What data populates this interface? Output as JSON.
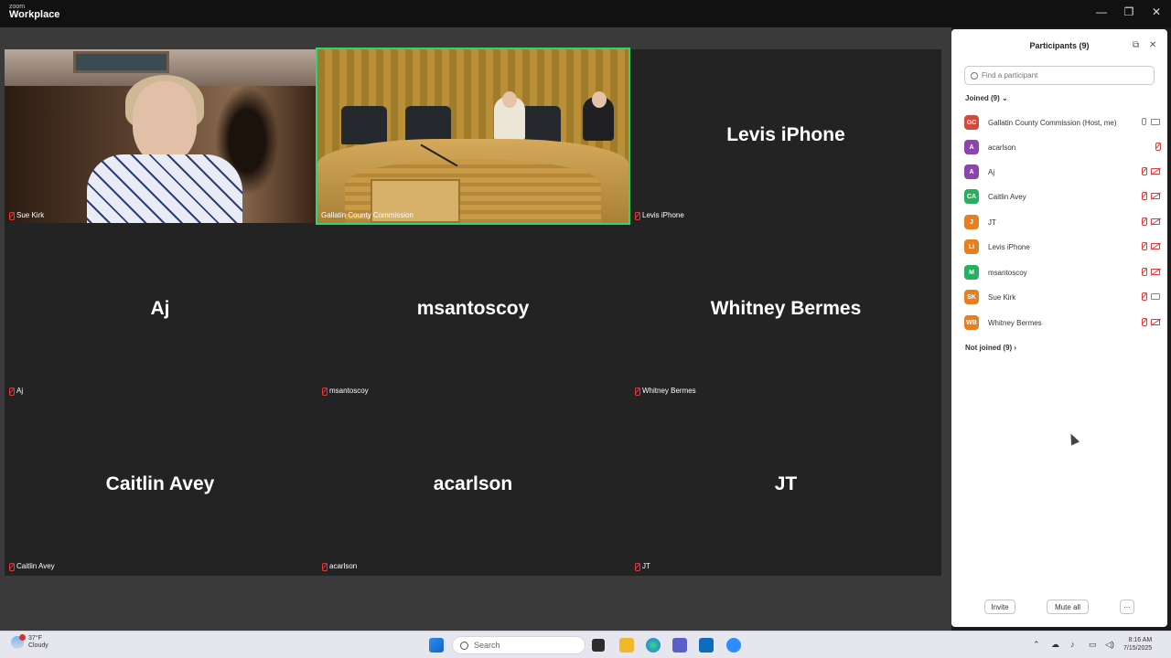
{
  "app": {
    "brand_small": "zoom",
    "brand_big": "Workplace"
  },
  "window_controls": {
    "minimize": "—",
    "maximize": "❐",
    "close": "✕"
  },
  "tiles": [
    {
      "id": "sue",
      "label": "Sue Kirk",
      "video": true
    },
    {
      "id": "commission",
      "label": "Gallatin County Commission",
      "video": true,
      "active": true
    },
    {
      "id": "levis",
      "name": "Levis iPhone",
      "label": "Levis iPhone"
    },
    {
      "id": "aj",
      "name": "Aj",
      "label": "Aj"
    },
    {
      "id": "msantoscoy",
      "name": "msantoscoy",
      "label": "msantoscoy"
    },
    {
      "id": "whitney",
      "name": "Whitney Bermes",
      "label": "Whitney Bermes"
    },
    {
      "id": "caitlin",
      "name": "Caitlin Avey",
      "label": "Caitlin Avey"
    },
    {
      "id": "acarlson",
      "name": "acarlson",
      "label": "acarlson"
    },
    {
      "id": "jt",
      "name": "JT",
      "label": "JT"
    }
  ],
  "panel": {
    "title": "Participants (9)",
    "search_placeholder": "Find a participant",
    "joined_label": "Joined (9)",
    "not_joined_label": "Not joined (9)",
    "participants": [
      {
        "initials": "GC",
        "name": "Gallatin County Commission (Host, me)",
        "color": "#d14a3a",
        "mic": "on",
        "cam": "on"
      },
      {
        "initials": "A",
        "name": "acarlson",
        "color": "#8e44ad",
        "mic": "off",
        "cam": "none"
      },
      {
        "initials": "A",
        "name": "Aj",
        "color": "#8e44ad",
        "mic": "off",
        "cam": "off"
      },
      {
        "initials": "CA",
        "name": "Caitlin Avey",
        "color": "#27ae60",
        "mic": "off",
        "cam": "off"
      },
      {
        "initials": "J",
        "name": "JT",
        "color": "#e67e22",
        "mic": "off",
        "cam": "off"
      },
      {
        "initials": "LI",
        "name": "Levis iPhone",
        "color": "#e67e22",
        "mic": "off",
        "cam": "off"
      },
      {
        "initials": "M",
        "name": "msantoscoy",
        "color": "#27ae60",
        "mic": "off",
        "cam": "off"
      },
      {
        "initials": "SK",
        "name": "Sue Kirk",
        "color": "#e67e22",
        "mic": "off",
        "cam": "on"
      },
      {
        "initials": "WB",
        "name": "Whitney Bermes",
        "color": "#e67e22",
        "mic": "off",
        "cam": "off"
      }
    ],
    "invite_label": "Invite",
    "mute_all_label": "Mute all",
    "more_label": "···"
  },
  "taskbar": {
    "weather_temp": "37°F",
    "weather_desc": "Cloudy",
    "search_placeholder": "Search",
    "time": "8:16 AM",
    "date": "7/15/2025"
  }
}
